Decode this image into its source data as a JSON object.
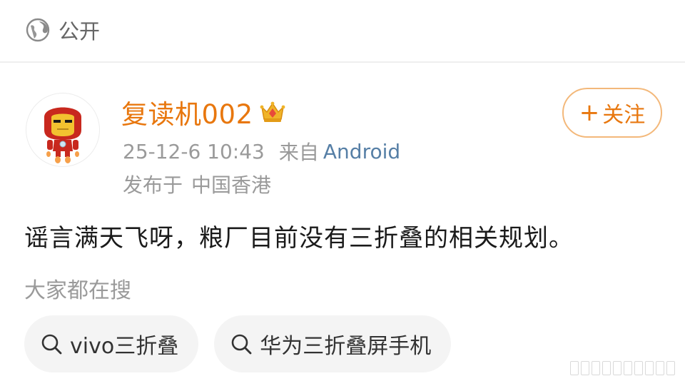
{
  "visibility": {
    "icon": "globe-icon",
    "label": "公开"
  },
  "post": {
    "author": {
      "name": "复读机002",
      "badge_icon": "crown-icon",
      "avatar_icon": "iron-man-avatar-icon"
    },
    "timestamp": "25-12-6 10:43",
    "from_label": "来自",
    "source": "Android",
    "location_prefix": "发布于",
    "location": "中国香港",
    "follow_label": "关注",
    "follow_plus": "+",
    "text": "谣言满天飞呀，粮厂目前没有三折叠的相关规划。"
  },
  "trending": {
    "label": "大家都在搜",
    "chips": [
      {
        "icon": "search-icon",
        "label": "vivo三折叠"
      },
      {
        "icon": "search-icon",
        "label": "华为三折叠屏手机"
      }
    ]
  },
  "colors": {
    "accent": "#e8770e",
    "link": "#567fa6",
    "muted": "#9a9a9a",
    "text": "#1a1a1a",
    "chip_bg": "#f4f4f4"
  }
}
